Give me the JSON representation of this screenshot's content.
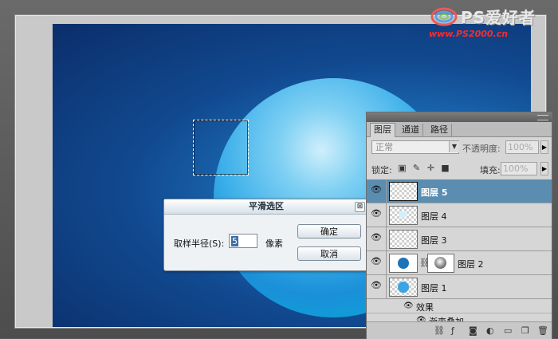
{
  "logo": {
    "title": "PS爱好者",
    "url": "www.PS2000.cn"
  },
  "dialog": {
    "title": "平滑选区",
    "close_glyph": "⊠",
    "radius_label": "取样半径(S):",
    "radius_value": "5",
    "unit_label": "像素",
    "ok_label": "确定",
    "cancel_label": "取消"
  },
  "panel": {
    "tabs": [
      {
        "label": "图层",
        "active": true
      },
      {
        "label": "通道",
        "active": false
      },
      {
        "label": "路径",
        "active": false
      }
    ],
    "blend_mode": "正常",
    "opacity_label": "不透明度:",
    "opacity_value": "100%",
    "lock_label": "锁定:",
    "fill_label": "填充:",
    "fill_value": "100%",
    "layers": [
      {
        "name": "图层 5",
        "active": true,
        "visible": true
      },
      {
        "name": "图层 4",
        "active": false,
        "visible": true
      },
      {
        "name": "图层 3",
        "active": false,
        "visible": true
      },
      {
        "name": "图层 2",
        "active": false,
        "visible": true
      },
      {
        "name": "图层 1",
        "active": false,
        "visible": true
      }
    ],
    "effects_label": "效果",
    "gradient_overlay_label": "渐变叠加"
  },
  "colors": {
    "canvas_dark": "#0b2e6b",
    "canvas_mid": "#1b6bb5",
    "sphere_light": "#cfeffc",
    "sphere_cyan": "#11c2e6",
    "active_layer": "#5b8db0"
  }
}
